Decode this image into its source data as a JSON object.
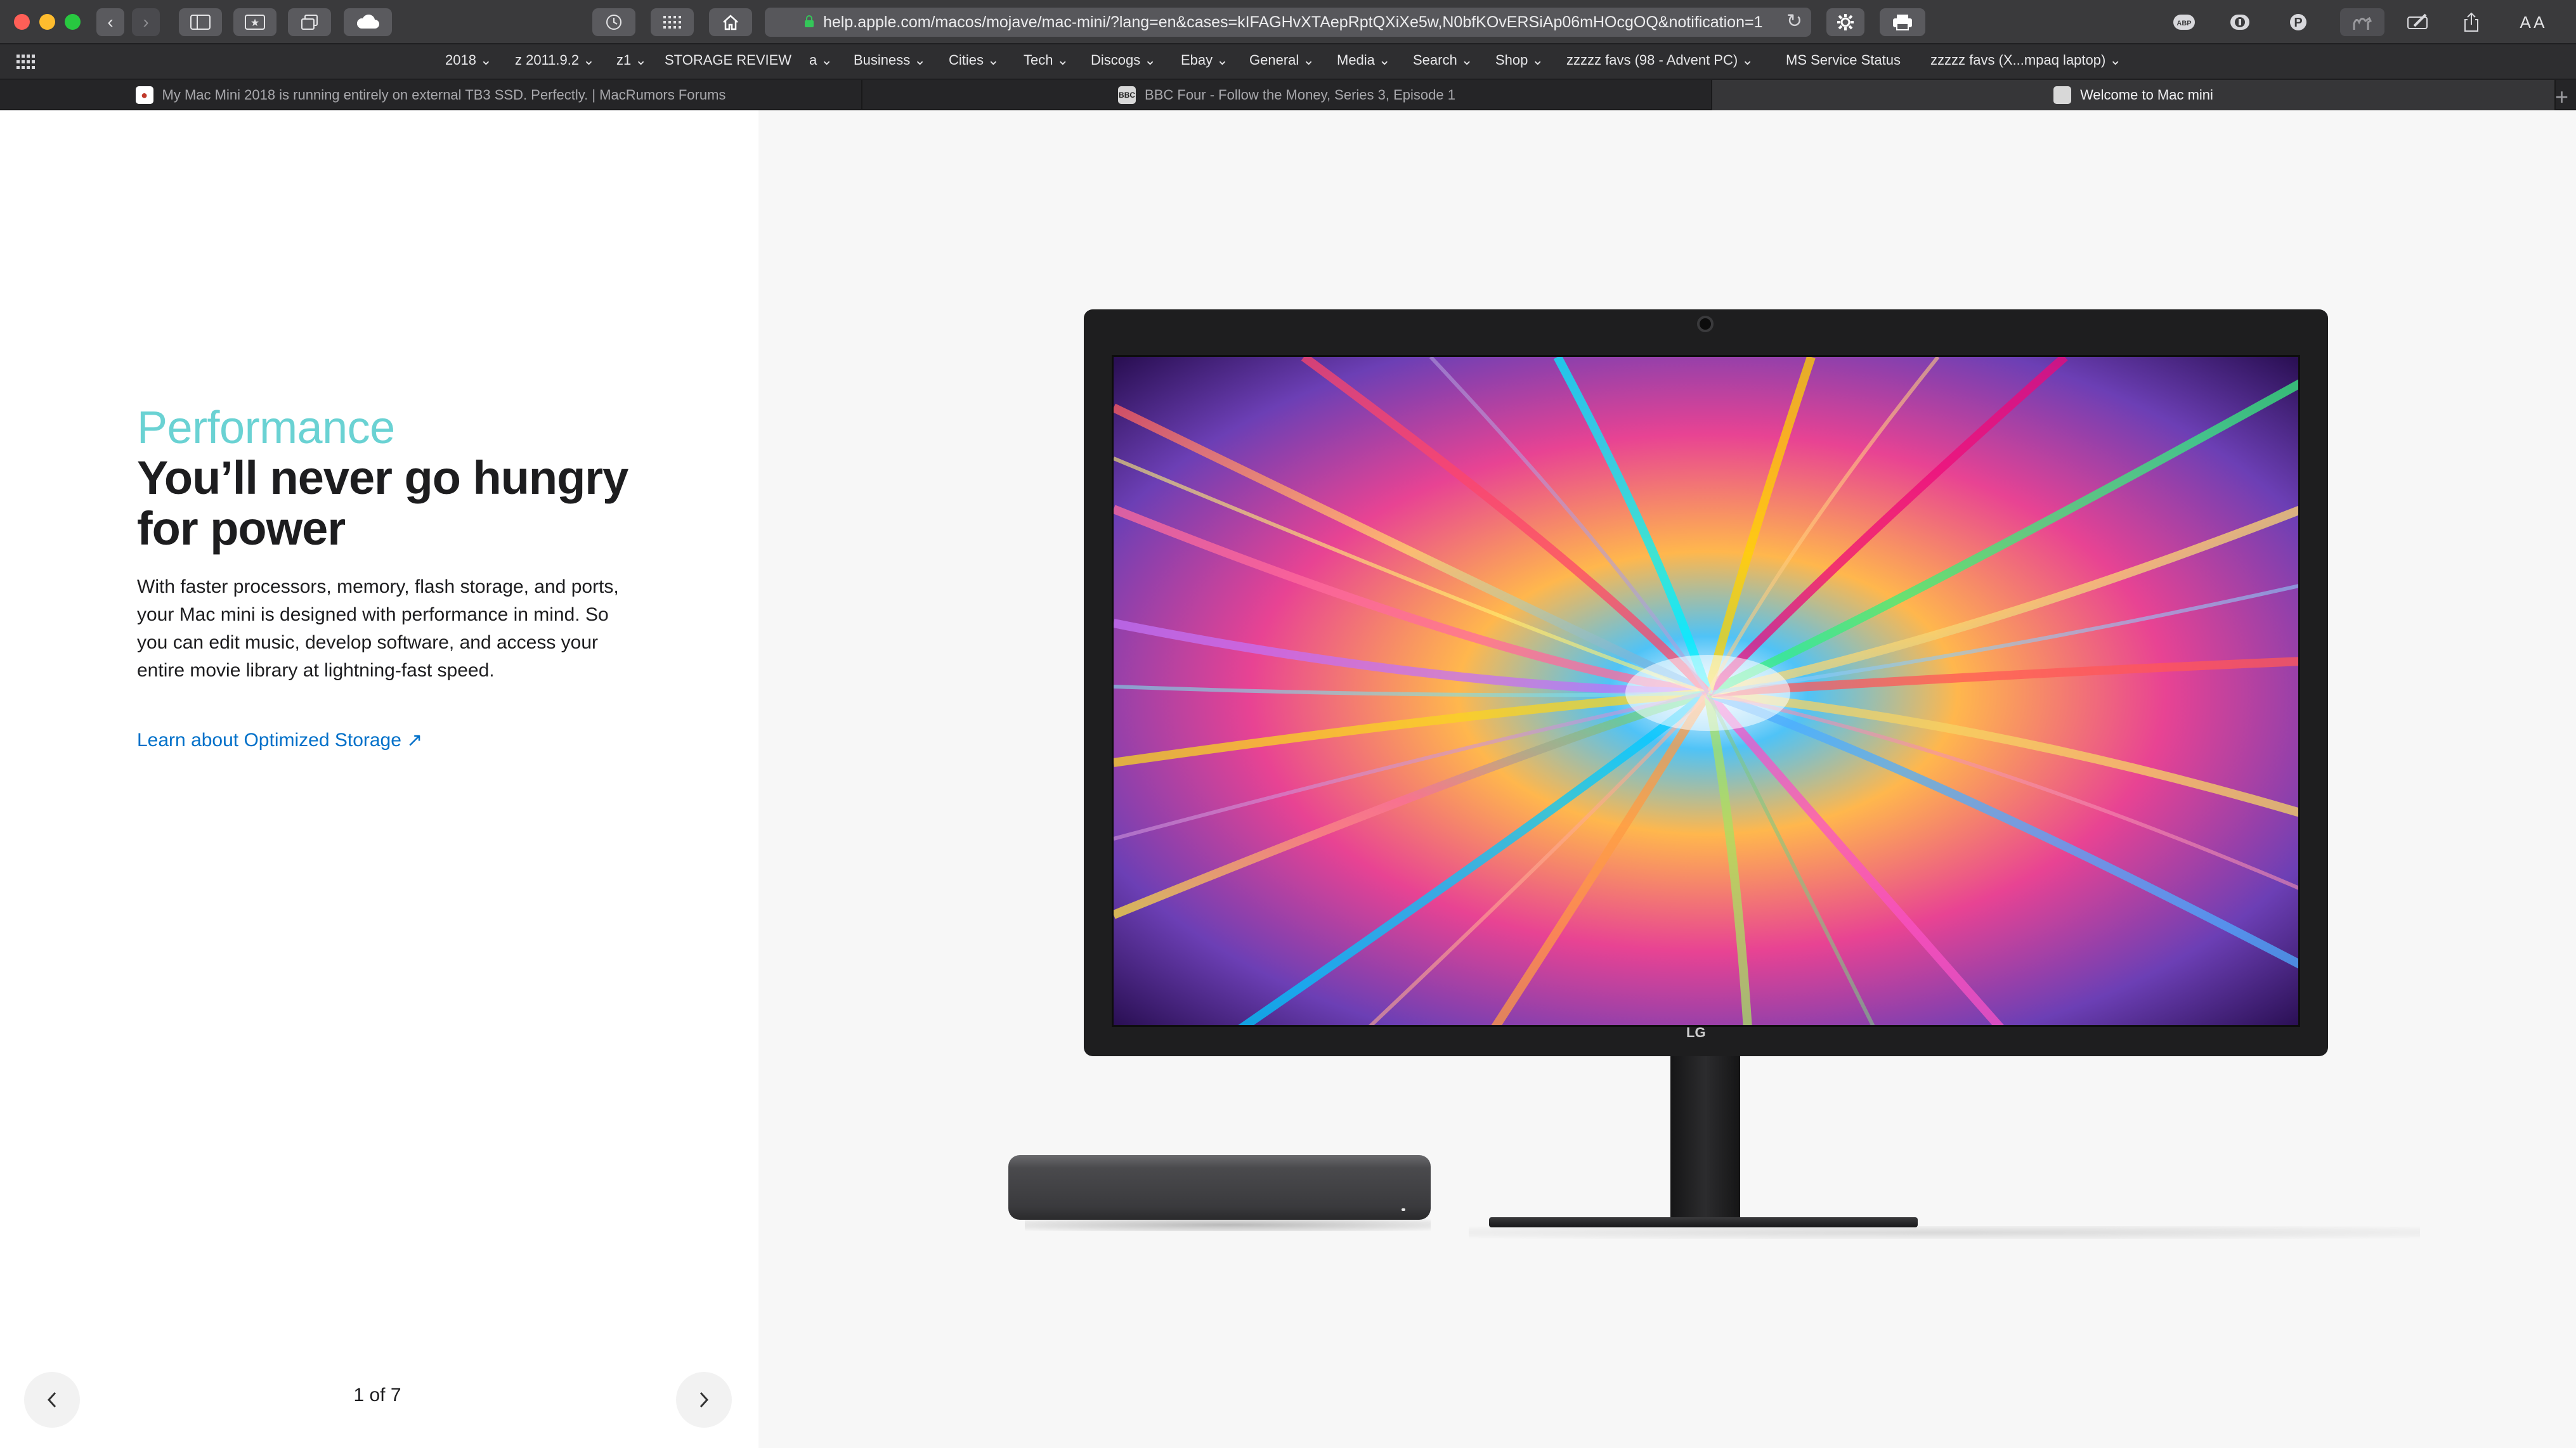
{
  "browser": {
    "url": "help.apple.com/macos/mojave/mac-mini/?lang=en&cases=kIFAGHvXTAepRptQXiXe5w,N0bfKOvERSiAp06mHOcgOQ&notification=1",
    "toolbar_icons": [
      "back-icon",
      "forward-icon",
      "sidebar-icon",
      "bookmark-icon",
      "tabs-overview-icon",
      "icloud-icon",
      "history-icon",
      "apps-grid-icon",
      "home-icon",
      "reload-icon",
      "settings-icon",
      "print-icon",
      "adblock-icon",
      "onepassword-icon",
      "pinterest-icon",
      "camel-icon",
      "annotate-icon",
      "share-icon",
      "text-size-icon"
    ],
    "text_size_label": "A A"
  },
  "favorites": [
    {
      "label": "2018",
      "dropdown": true
    },
    {
      "label": "z 2011.9.2",
      "dropdown": true
    },
    {
      "label": "z1",
      "dropdown": true
    },
    {
      "label": "STORAGE REVIEW",
      "dropdown": false
    },
    {
      "label": "a",
      "dropdown": true
    },
    {
      "label": "Business",
      "dropdown": true
    },
    {
      "label": "Cities",
      "dropdown": true
    },
    {
      "label": "Tech",
      "dropdown": true
    },
    {
      "label": "Discogs",
      "dropdown": true
    },
    {
      "label": "Ebay",
      "dropdown": true
    },
    {
      "label": "General",
      "dropdown": true
    },
    {
      "label": "Media",
      "dropdown": true
    },
    {
      "label": "Search",
      "dropdown": true
    },
    {
      "label": "Shop",
      "dropdown": true
    },
    {
      "label": "zzzzz favs (98 - Advent PC)",
      "dropdown": true
    },
    {
      "label": "MS Service Status",
      "dropdown": false
    },
    {
      "label": "zzzzz favs (X...mpaq laptop)",
      "dropdown": true
    }
  ],
  "tabs": [
    {
      "title": "My Mac Mini 2018 is running entirely on external TB3 SSD. Perfectly. | MacRumors Forums",
      "active": false
    },
    {
      "title": "BBC Four - Follow the Money, Series 3, Episode 1",
      "active": false
    },
    {
      "title": "Welcome to Mac mini",
      "active": true
    }
  ],
  "content": {
    "eyebrow": "Performance",
    "headline": "You’ll never go hungry for power",
    "body": "With faster processors, memory, flash storage, and ports, your Mac mini is designed with performance in mind. So you can edit music, develop software, and access your entire movie library at lightning-fast speed.",
    "link": "Learn about Optimized Storage ↗",
    "monitor_logo": "LG"
  },
  "pager": {
    "label": "1 of 7",
    "prev_icon": "chevron-left-icon",
    "next_icon": "chevron-right-icon"
  },
  "colors": {
    "eyebrow": "#6ad2d3",
    "link": "#0070c9",
    "chrome_toolbar": "#3a3a3c",
    "favbar": "#2e2e30",
    "tabbar": "#252527"
  }
}
